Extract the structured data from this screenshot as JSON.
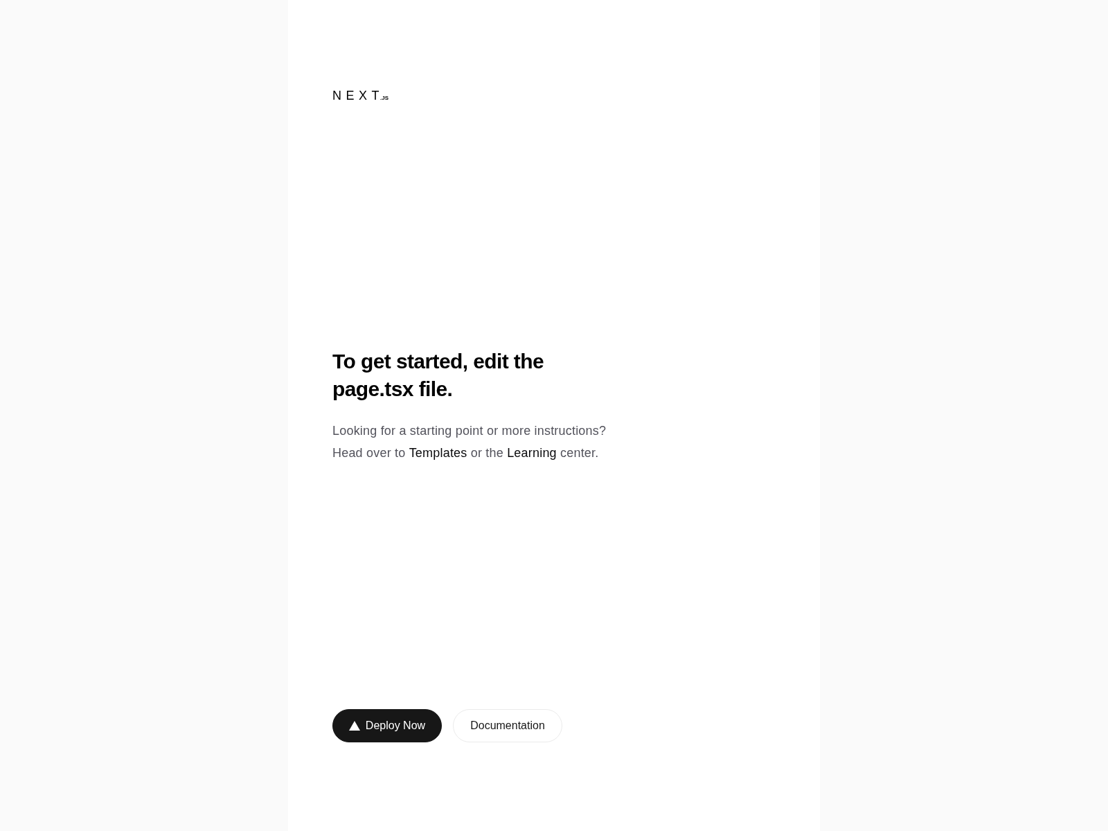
{
  "logo": {
    "wordmark": "NEXT",
    "suffix": ".JS"
  },
  "heading": "To get started, edit the page.tsx file.",
  "intro": {
    "parts": [
      {
        "kind": "text",
        "text": "Looking for a starting point or more instructions? Head over to "
      },
      {
        "kind": "link",
        "text": "Templates"
      },
      {
        "kind": "text",
        "text": " or the "
      },
      {
        "kind": "link",
        "text": "Learning"
      },
      {
        "kind": "text",
        "text": " center."
      }
    ]
  },
  "buttons": [
    {
      "kind": "primary",
      "label": "Deploy Now"
    },
    {
      "kind": "secondary",
      "label": "Documentation"
    }
  ]
}
